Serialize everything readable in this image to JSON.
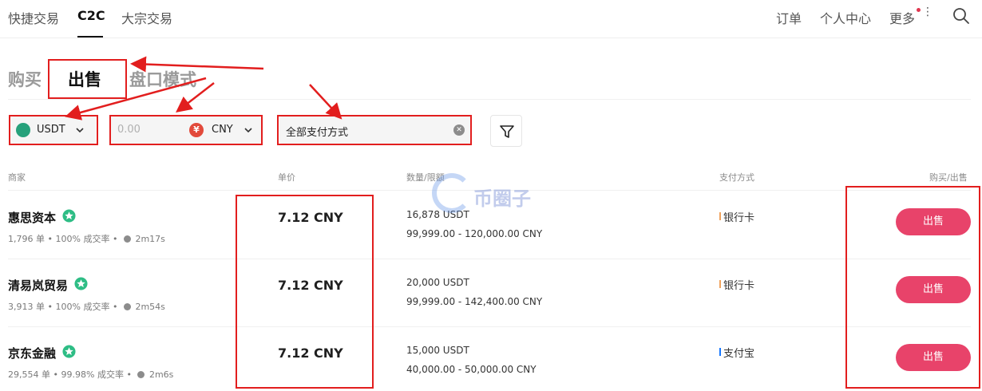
{
  "nav": {
    "tabs": [
      "快捷交易",
      "C2C",
      "大宗交易"
    ],
    "active_tab": "C2C",
    "right_items": [
      "订单",
      "个人中心",
      "更多"
    ]
  },
  "modes": {
    "buy": "购买",
    "sell": "出售",
    "orderbook": "盘口模式",
    "active": "出售"
  },
  "filters": {
    "coin": "USDT",
    "amount_placeholder": "0.00",
    "currency_symbol": "¥",
    "currency": "CNY",
    "payment": "全部支付方式"
  },
  "table": {
    "headers": [
      "商家",
      "单价",
      "数量/限额",
      "支付方式",
      "购买/出售"
    ],
    "rows": [
      {
        "merchant": "惠思资本",
        "orders": "1,796 单",
        "completion": "100% 成交率",
        "time": "2m17s",
        "price": "7.12 CNY",
        "quantity": "16,878 USDT",
        "limit": "99,999.00 - 120,000.00 CNY",
        "payment": "银行卡",
        "payment_color": "#f0a35e",
        "action": "出售"
      },
      {
        "merchant": "清易岚贸易",
        "orders": "3,913 单",
        "completion": "100% 成交率",
        "time": "2m54s",
        "price": "7.12 CNY",
        "quantity": "20,000 USDT",
        "limit": "99,999.00 - 142,400.00 CNY",
        "payment": "银行卡",
        "payment_color": "#f0a35e",
        "action": "出售"
      },
      {
        "merchant": "京东金融",
        "orders": "29,554 单",
        "completion": "99.98% 成交率",
        "time": "2m6s",
        "price": "7.12 CNY",
        "quantity": "15,000 USDT",
        "limit": "40,000.00 - 50,000.00 CNY",
        "payment": "支付宝",
        "payment_color": "#1677ff",
        "action": "出售"
      }
    ]
  },
  "watermark": "币圈子",
  "colors": {
    "accent": "#e8436a",
    "annotation": "#e21e1e",
    "verified": "#2ebd85"
  }
}
